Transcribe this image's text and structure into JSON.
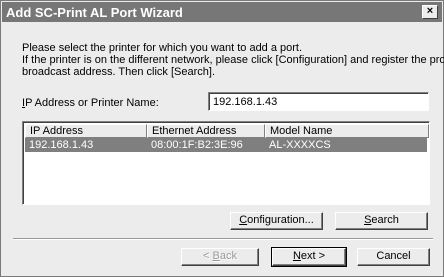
{
  "window": {
    "title": "Add SC-Print AL Port Wizard",
    "close_glyph": "×"
  },
  "instructions": {
    "line1": "Please select the printer for which you want to add a port.",
    "line2": "If the printer is on the different network, please click [Configuration] and register the proper",
    "line3": "broadcast address. Then click [Search]."
  },
  "ip_field": {
    "label_prefix": "I",
    "label_rest": "P Address or Printer Name:",
    "value": "192.168.1.43"
  },
  "printer_list": {
    "columns": [
      "IP Address",
      "Ethernet Address",
      "Model Name"
    ],
    "rows": [
      [
        "192.168.1.43",
        "08:00:1F:B2:3E:96",
        "AL-XXXXCS"
      ]
    ],
    "selected_row": 0
  },
  "buttons": {
    "configuration": {
      "mnemonic": "C",
      "rest": "onfiguration..."
    },
    "search": {
      "mnemonic": "S",
      "rest": "earch"
    },
    "back": {
      "prefix": "< ",
      "mnemonic": "B",
      "rest": "ack"
    },
    "next": {
      "mnemonic": "N",
      "rest": "ext >"
    },
    "cancel": {
      "label": "Cancel"
    }
  }
}
